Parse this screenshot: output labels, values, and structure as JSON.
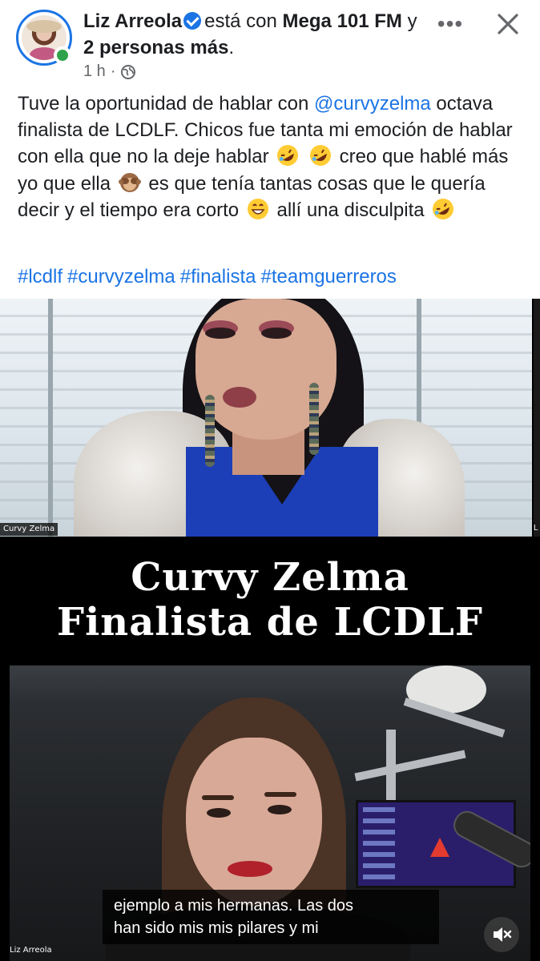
{
  "header": {
    "author": "Liz Arreola",
    "with_text": "está con",
    "tagged_page": "Mega 101 FM",
    "and_text": "y",
    "others": "2 personas más",
    "period": ".",
    "time": "1 h",
    "separator": "·",
    "privacy_icon": "globe-icon",
    "more_icon": "more-horizontal-icon",
    "close_icon": "close-icon",
    "more_label": "•••"
  },
  "post": {
    "line1_a": "Tuve la oportunidad de hablar con ",
    "mention": "@curvyzelma",
    "line2": " octava finalista de LCDLF. Chicos fue tanta mi emoción de hablar con ella que no la deje hablar ",
    "segment2": " creo que hablé más yo que ella ",
    "segment3": " es que tenía tantas cosas que le quería decir y el tiempo era corto ",
    "segment4": " allí una disculpita ",
    "emoji_names": [
      "rolling-on-floor-laughing-emoji",
      "see-no-evil-monkey-emoji",
      "grinning-face-emoji"
    ],
    "hashtags": [
      "#lcdlf",
      "#curvyzelma",
      "#finalista",
      "#teamguerreros"
    ]
  },
  "video": {
    "top_name_tag": "Curvy Zelma",
    "right_tag": "L",
    "banner_line1": "Curvy Zelma",
    "banner_line2": "Finalista de LCDLF",
    "bottom_name_tag": "Liz Arreola",
    "subtitle_line1": "ejemplo a mis hermanas. Las dos",
    "subtitle_line2": "han sido mis mis pilares y mi",
    "mute_icon": "speaker-muted-icon"
  },
  "colors": {
    "link": "#1b74e4",
    "online": "#31a24c",
    "text": "#1c1e21",
    "meta": "#65676b"
  }
}
